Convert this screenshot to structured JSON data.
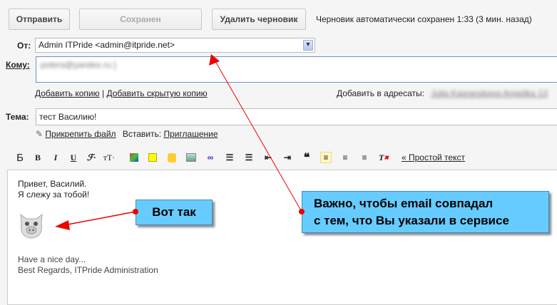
{
  "toolbar": {
    "send": "Отправить",
    "saved": "Сохранен",
    "delete_draft": "Удалить черновик",
    "status": "Черновик автоматически сохранен 1:33 (3 мин. назад)"
  },
  "from": {
    "label": "От:",
    "value": "Admin ITPride <admin@itpride.net>"
  },
  "to": {
    "label": "Кому:",
    "value": "poterа@yandex.ru ]"
  },
  "links": {
    "add_cc": "Добавить копию",
    "sep": "|",
    "add_bcc": "Добавить скрытую копию",
    "add_recipients": "Добавить в адресаты:",
    "recipients_value": "Julia Kapranskaya Angelika 13"
  },
  "subject": {
    "label": "Тема:",
    "value": "тест Василию!"
  },
  "attach": {
    "attach_file": "Прикрепить файл",
    "insert_label": "Вставить:",
    "invitation": "Приглашение"
  },
  "format": {
    "font_glyph": "Б",
    "bold": "B",
    "italic": "I",
    "underline": "U",
    "font": "ℱ·",
    "size": "тT·",
    "plain_text": "« Простой текст"
  },
  "body": {
    "line1": "Привет, Василий.",
    "line2": "Я слежу за тобой!",
    "line3": "Have a nice day...",
    "line4": "Best Regards, ITPride Administration"
  },
  "callouts": {
    "small": "Вот так",
    "big_line1": "Важно, чтобы email совпадал",
    "big_line2": "с тем, что Вы указали в сервисе"
  },
  "colors": {
    "callout": "#66ccff",
    "arrow": "#e00000"
  }
}
